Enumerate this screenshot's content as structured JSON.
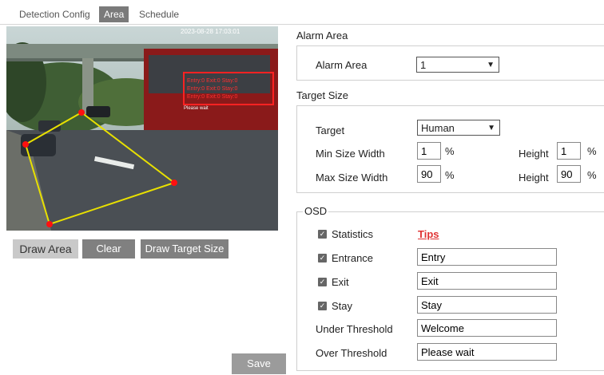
{
  "tabs": {
    "detection_config": "Detection Config",
    "area": "Area",
    "schedule": "Schedule"
  },
  "video": {
    "overlay_text": "2023-08-28 17:03:01",
    "box_lines": [
      "Entry:0 Exit:0 Stay:0",
      "Entry:0 Exit:0 Stay:0",
      "Entry:0 Exit:0 Stay:0"
    ],
    "caption": "Please wait",
    "bus_color": "#8a1a1a",
    "area_color": "#e8e000",
    "vertex_color": "#ff1010"
  },
  "left_buttons": {
    "draw_area": "Draw Area",
    "clear": "Clear",
    "draw_target_size": "Draw Target Size",
    "save": "Save"
  },
  "alarm_area": {
    "section": "Alarm Area",
    "label": "Alarm Area",
    "value": "1"
  },
  "target_size": {
    "section": "Target Size",
    "target_label": "Target",
    "target_value": "Human",
    "min_label": "Min Size Width",
    "min_width": "1",
    "min_height": "1",
    "max_label": "Max Size Width",
    "max_width": "90",
    "max_height": "90",
    "height_label": "Height",
    "unit": "%"
  },
  "osd": {
    "legend": "OSD",
    "statistics": "Statistics",
    "tips": "Tips",
    "entrance": "Entrance",
    "entrance_value": "Entry",
    "exit": "Exit",
    "exit_value": "Exit",
    "stay": "Stay",
    "stay_value": "Stay",
    "under_threshold": "Under Threshold",
    "under_value": "Welcome",
    "over_threshold": "Over Threshold",
    "over_value": "Please wait",
    "check_glyph": "✓"
  }
}
